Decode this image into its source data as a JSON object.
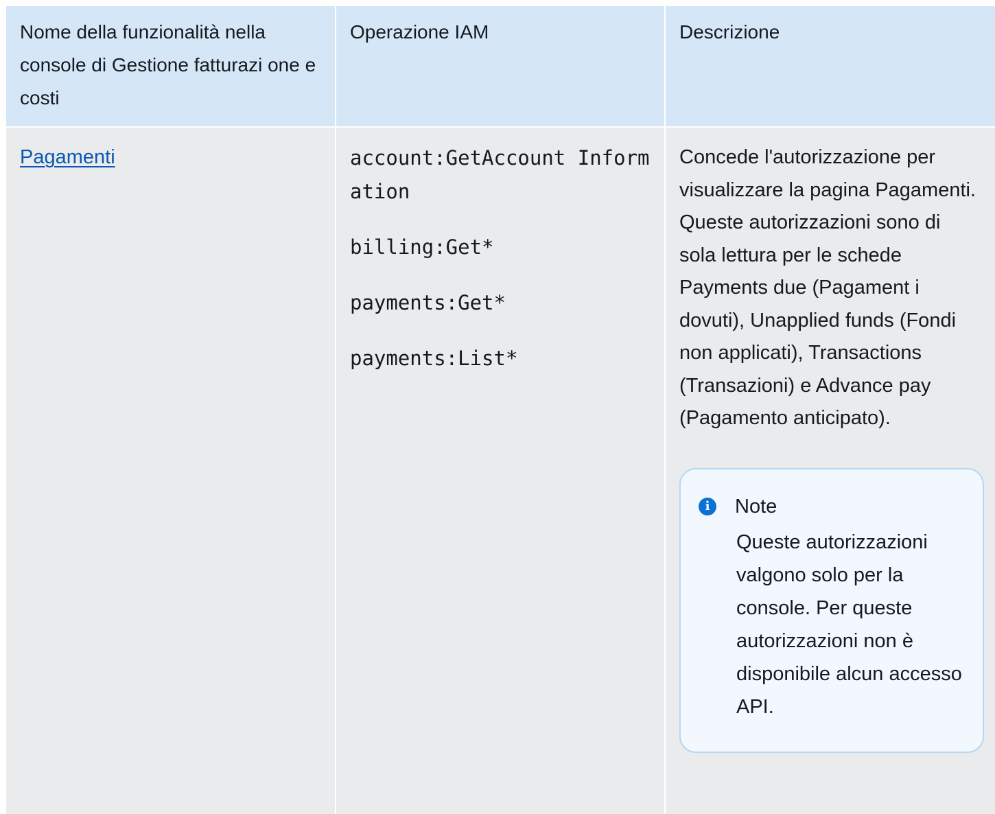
{
  "table": {
    "headers": [
      "Nome della funzionalità nella console di Gestione fatturazi one e costi",
      "Operazione IAM",
      "Descrizione"
    ],
    "rows": [
      {
        "feature": "Pagamenti",
        "operations": [
          "account:GetAccount Information",
          "billing:Get*",
          "payments:Get*",
          "payments:List*"
        ],
        "description": "Concede l'autorizzazione per visualizzare la pagina Pagamenti. Queste autorizzazioni sono di sola lettura per le schede Payments due (Pagament i dovuti), Unapplied funds (Fondi non applicati), Transactions (Transazioni) e Advance pay (Pagamento anticipato).",
        "note": {
          "title": "Note",
          "body": "Queste autorizzazioni valgono solo per la console. Per queste autorizzazioni non è disponibile alcun accesso API."
        }
      }
    ]
  },
  "colors": {
    "header_bg": "#d5e7f7",
    "row_bg": "#e9ebed",
    "link": "#0b59b4",
    "note_border": "#b6d8f2",
    "note_bg": "#f2f8fd",
    "info_icon": "#0972d3"
  },
  "icons": {
    "note_icon": "info-icon"
  }
}
